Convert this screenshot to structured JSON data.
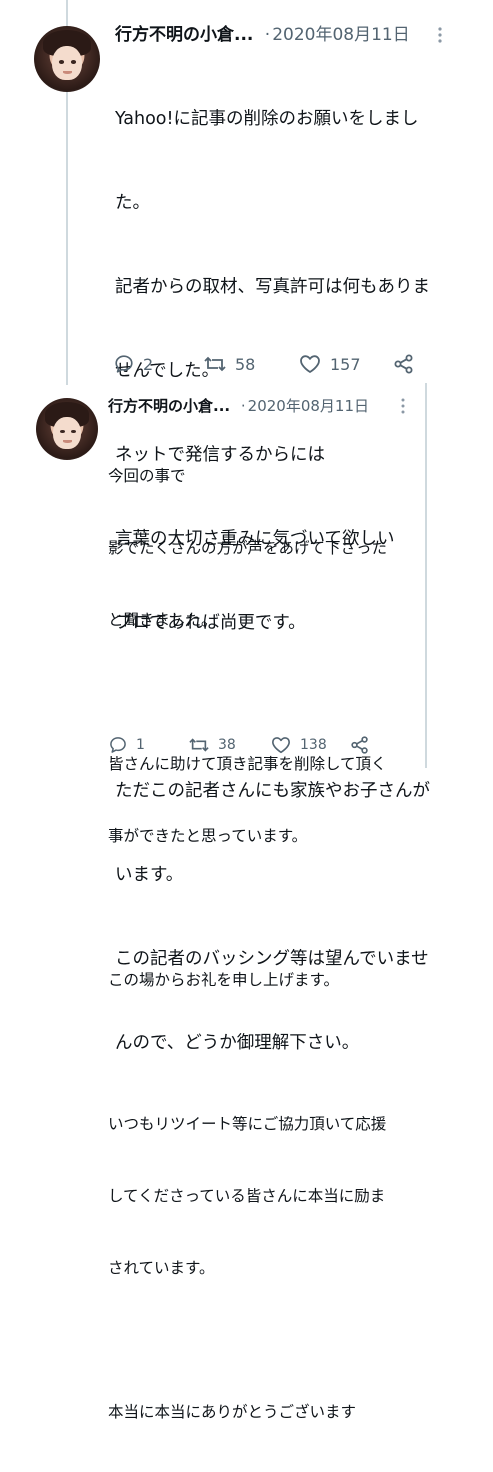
{
  "tweets": [
    {
      "name": "行方不明の小倉...",
      "separator": "·",
      "date": "2020年08月11日",
      "text": "Yahoo!に記事の削除のお願いをしました。\n記者からの取材、写真許可は何もありませんでした。\nネットで発信するからには\n言葉の大切さ重みに気づいて欲しい\nプロであれば尚更です。\n\nただこの記者さんにも家族やお子さんがいます。\nこの記者のバッシング等は望んでいませんので、どうか御理解下さい。",
      "lines": [
        "Yahoo!に記事の削除のお願いをしまし",
        "た。",
        "記者からの取材、写真許可は何もありま",
        "せんでした。",
        "ネットで発信するからには",
        "言葉の大切さ重みに気づいて欲しい",
        "プロであれば尚更です。",
        "",
        "ただこの記者さんにも家族やお子さんが",
        "います。",
        "この記者のバッシング等は望んでいませ",
        "んので、どうか御理解下さい。"
      ],
      "replies": "2",
      "retweets": "58",
      "likes": "157"
    },
    {
      "name": "行方不明の小倉...",
      "separator": "·",
      "date": "2020年08月11日",
      "lines": [
        "今回の事で",
        "影でたくさんの方が声をあげて下さった",
        "と聞きました。",
        "",
        "皆さんに助けて頂き記事を削除して頂く",
        "事ができたと思っています。",
        "",
        "この場からお礼を申し上げます。",
        "",
        "いつもリツイート等にご協力頂いて応援",
        "してくださっている皆さんに本当に励ま",
        "されています。",
        "",
        "本当に本当にありがとうございます"
      ],
      "replies": "1",
      "retweets": "38",
      "likes": "138"
    }
  ],
  "icons": {
    "reply": "reply-icon",
    "retweet": "retweet-icon",
    "like": "heart-icon",
    "share": "share-icon",
    "more": "more-icon"
  },
  "colors": {
    "text": "#0f1419",
    "secondary": "#536471",
    "line": "#cfd9de"
  }
}
